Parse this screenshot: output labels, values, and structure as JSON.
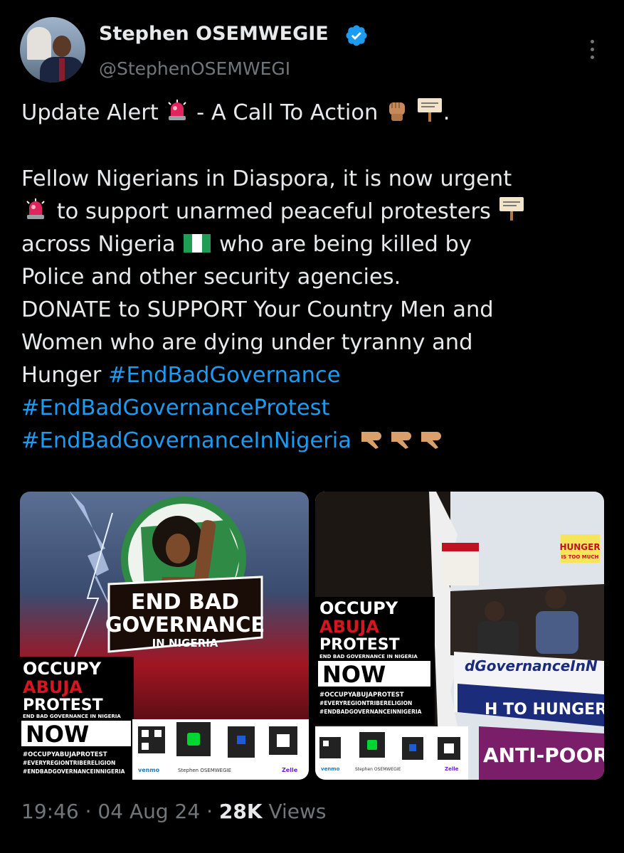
{
  "author": {
    "name": "Stephen OSEMWEGIE",
    "handle": "@StephenOSEMWEGI",
    "verified": true
  },
  "tweet": {
    "line1": "Update Alert",
    "line1b": "- A Call To Action",
    "p1": "Fellow Nigerians in Diaspora, it is now urgent",
    "p2": "to support unarmed peaceful protesters",
    "p3a": "across Nigeria",
    "p3b": "who are being killed by",
    "p4": "Police and other security agencies.",
    "p5": "DONATE to SUPPORT Your Country Men and",
    "p6": "Women who are dying under tyranny and",
    "p7": "Hunger",
    "hashtags": [
      "#EndBadGovernance",
      "#EndBadGovernanceProtest",
      "#EndBadGovernanceInNigeria"
    ]
  },
  "images": [
    {
      "end_bad": "END BAD",
      "governance": "GOVERNANCE",
      "in_nigeria": "IN NIGERIA",
      "occupy": "OCCUPY",
      "abuja": "ABUJA",
      "protest": "PROTEST",
      "subtitle": "END BAD GOVERNANCE IN NIGERIA",
      "now": "NOW",
      "tags": [
        "#OCCUPYABUJAPROTEST",
        "#EVERYREGIONTRIBERELIGION",
        "#ENDBADGOVERNANCEINNIGERIA"
      ],
      "payments": [
        "venmo",
        "Stephen OSEMWEGIE",
        "Zelle"
      ]
    },
    {
      "occupy": "OCCUPY",
      "abuja": "ABUJA",
      "protest": "PROTEST",
      "subtitle": "END BAD GOVERNANCE IN NIGERIA",
      "now": "NOW",
      "tags": [
        "#OCCUPYABUJAPROTEST",
        "#EVERYREGIONTRIBERELIGION",
        "#ENDBADGOVERNANCEINNIGERIA"
      ],
      "banner": "dGovernanceInN",
      "banner2": "H TO HUNGER AN",
      "banner3": "ANTI-POOR",
      "placard_hunger": "HUNGER",
      "placard_sub": "IS TOO MUCH",
      "payments": [
        "venmo",
        "Stephen OSEMWEGIE",
        "Zelle"
      ]
    }
  ],
  "meta": {
    "time": "19:46",
    "date": "04 Aug 24",
    "views_count": "28K",
    "views_label": "Views"
  },
  "colors": {
    "background": "#000000",
    "text": "#e7e9ea",
    "secondary": "#71767b",
    "link": "#1d9bf0",
    "verified": "#1d9bf0"
  }
}
